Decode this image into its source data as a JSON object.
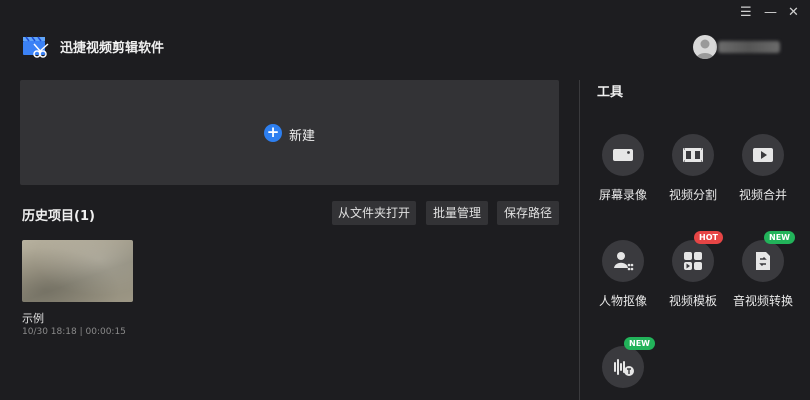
{
  "window": {
    "menu_icon": "☰",
    "minimize_icon": "—",
    "close_icon": "✕"
  },
  "app": {
    "title": "迅捷视频剪辑软件",
    "logo_icon": "clapperboard-scissors-icon",
    "accent": "#2d7ff0"
  },
  "user": {
    "avatar_icon": "user-avatar-icon"
  },
  "new_project": {
    "label": "新建",
    "plus_icon": "+"
  },
  "history": {
    "title": "历史项目(1)",
    "buttons": [
      "从文件夹打开",
      "批量管理",
      "保存路径"
    ],
    "items": [
      {
        "name": "示例",
        "meta": "10/30 18:18 | 00:00:15"
      }
    ]
  },
  "tools": {
    "title": "工具",
    "items": [
      {
        "label": "屏幕录像",
        "icon": "camera-icon"
      },
      {
        "label": "视频分割",
        "icon": "film-split-icon"
      },
      {
        "label": "视频合并",
        "icon": "play-merge-icon"
      },
      {
        "label": "人物抠像",
        "icon": "person-cutout-icon"
      },
      {
        "label": "视频模板",
        "icon": "template-icon",
        "badge": "HOT"
      },
      {
        "label": "音视频转换",
        "icon": "convert-icon",
        "badge": "NEW"
      },
      {
        "label": "",
        "icon": "audio-text-icon",
        "badge": "NEW"
      }
    ]
  }
}
